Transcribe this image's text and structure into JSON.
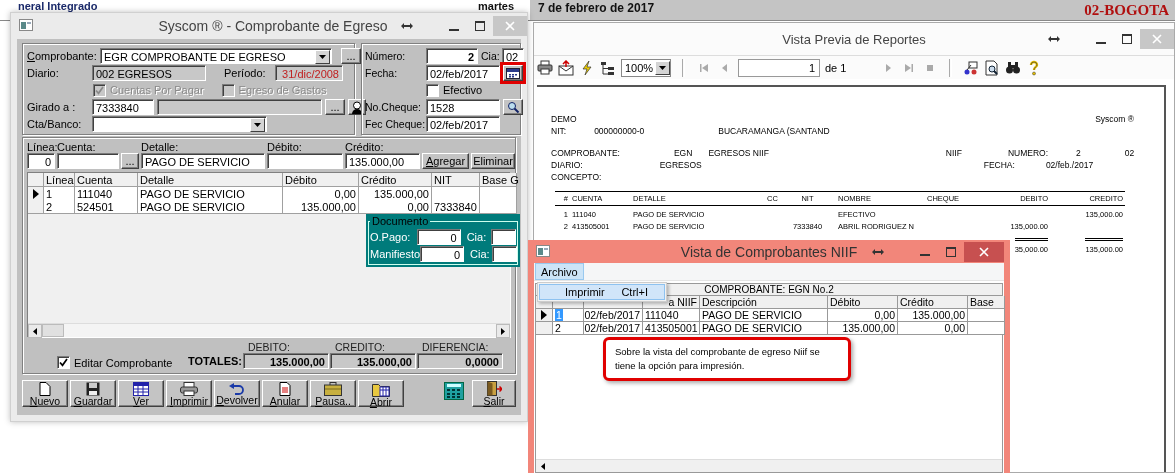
{
  "background": {
    "app_title": "neral Integrado",
    "weekday": "martes",
    "date": "7 de febrero de 2017",
    "branch": "02-BOGOTA"
  },
  "egreso_window": {
    "title": "Syscom ® - Comprobante de Egreso",
    "comprobante": {
      "label": "Comprobante:",
      "value": "EGR COMPROBANTE DE EGRESO",
      "button": "..."
    },
    "diario": {
      "label": "Diario:",
      "value": "002 EGRESOS"
    },
    "periodo": {
      "label": "Período:",
      "value": "31/dic/2008"
    },
    "options": [
      {
        "label": "Cuentas Por Pagar",
        "checked": true,
        "disabled": true
      },
      {
        "label": "Egreso de Gastos",
        "checked": false,
        "disabled": true
      }
    ],
    "girado_a": {
      "label": "Girado a :",
      "value": "7333840",
      "button": "..."
    },
    "cta_banco": {
      "label": "Cta/Banco:"
    },
    "numero": {
      "label": "Número:",
      "value": "2"
    },
    "cia": {
      "label": "Cia:",
      "value": "02"
    },
    "fecha": {
      "label": "Fecha:",
      "value": "02/feb/2017",
      "calendar_highlighted": true
    },
    "efectivo": {
      "label": "Efectivo",
      "checked": false
    },
    "no_cheque": {
      "label": "No.Cheque:",
      "value": "1528"
    },
    "fec_cheque": {
      "label": "Fec Cheque:",
      "value": "02/feb/2017"
    },
    "entry": {
      "labels": [
        "Línea:",
        "Cuenta:",
        "Detalle:",
        "Débito:",
        "Crédito:"
      ],
      "linea": "0",
      "button": "...",
      "detalle": "PAGO DE SERVICIO",
      "credito": "135.000,00"
    },
    "entry_buttons": [
      "Agregar",
      "Eliminar"
    ],
    "grid": {
      "columns": [
        "Línea",
        "Cuenta",
        "Detalle",
        "Débito",
        "Crédito",
        "NIT",
        "Base G"
      ],
      "rows": [
        {
          "selected": true,
          "linea": "1",
          "cuenta": "111040",
          "detalle": "PAGO DE SERVICIO",
          "debito": "0,00",
          "credito": "135.000,00"
        },
        {
          "selected": false,
          "linea": "2",
          "cuenta": "524501",
          "detalle": "PAGO DE SERVICIO",
          "debito": "135.000,00",
          "credito": "0,00",
          "nit": "7333840"
        }
      ]
    },
    "documento": {
      "legend": "Documento",
      "fields": [
        {
          "label": "O.Pago:",
          "value": "0",
          "cia_label": "Cia:"
        },
        {
          "label": "Manifiesto",
          "value": "0",
          "cia_label": "Cia:"
        }
      ]
    },
    "totals": {
      "headings": [
        "DEBITO:",
        "CREDITO:",
        "DIFERENCIA:"
      ],
      "label": "TOTALES:",
      "values": [
        "135.000,00",
        "135.000,00",
        "0,0000"
      ]
    },
    "editar": {
      "label": "Editar Comprobante",
      "checked": true
    },
    "buttons": [
      {
        "kind": "new",
        "label": "Nuevo"
      },
      {
        "kind": "save",
        "label": "Guardar"
      },
      {
        "kind": "view",
        "label": "Ver"
      },
      {
        "kind": "print",
        "label": "Imprimir"
      },
      {
        "kind": "return",
        "label": "Devolver"
      },
      {
        "kind": "cancel",
        "label": "Anular"
      },
      {
        "kind": "pause",
        "label": "Pausa.."
      },
      {
        "kind": "open",
        "label": "Abrir"
      },
      {
        "kind": "calculator"
      },
      {
        "kind": "exit",
        "label": "Salir"
      }
    ]
  },
  "report_window": {
    "title": "Vista Previa de Reportes",
    "zoom": "100%",
    "page": "1",
    "page_of": "de 1",
    "report": {
      "company": "DEMO",
      "brand": "Syscom ®",
      "nit_label": "NIT:",
      "nit": "000000000-0",
      "city": "BUCARAMANGA (SANTAND",
      "comprobante_label": "COMPROBANTE:",
      "comprobante_code": "EGN",
      "comprobante_name": "EGRESOS NIIF",
      "norma": "NIIF",
      "numero_label": "NUMERO:",
      "numero": "2",
      "cia": "02",
      "diario_label": "DIARIO:",
      "diario": "EGRESOS",
      "fecha_label": "FECHA:",
      "fecha": "02/feb./2017",
      "concepto_label": "CONCEPTO:",
      "columns": [
        "#",
        "CUENTA",
        "DETALLE",
        "CC",
        "NIT",
        "NOMBRE",
        "CHEQUE",
        "DEBITO",
        "CREDITO"
      ],
      "rows": [
        {
          "n": "1",
          "cuenta": "111040",
          "detalle": "PAGO DE SERVICIO",
          "nombre": "EFECTIVO",
          "credito": "135,000.00"
        },
        {
          "n": "2",
          "cuenta": "413505001",
          "detalle": "PAGO DE SERVICIO",
          "nit": "7333840",
          "nombre": "ABRIL RODRIGUEZ N",
          "debito": "135,000.00"
        }
      ],
      "totals": {
        "debito": "35,000.00",
        "credito": "135,000.00"
      }
    }
  },
  "niif_window": {
    "title": "Vista de Comprobantes NIIF",
    "menu": [
      {
        "label": "Archivo",
        "selected": true
      }
    ],
    "menu_items": [
      {
        "label": "Imprimir",
        "shortcut": "Ctrl+I"
      }
    ],
    "caption": "COMPROBANTE: EGN No.2",
    "columns": [
      "a NIIF",
      "Descripción",
      "Débito",
      "Crédito",
      "Base"
    ],
    "rows": [
      {
        "selected": true,
        "linea": "1",
        "fecha": "02/feb/2017",
        "cuenta": "111040",
        "descripcion": "PAGO DE SERVICIO",
        "debito": "0,00",
        "credito": "135.000,00"
      },
      {
        "selected": false,
        "linea": "2",
        "fecha": "02/feb/2017",
        "cuenta": "413505001",
        "descripcion": "PAGO DE SERVICIO",
        "debito": "135.000,00",
        "credito": "0,00"
      }
    ],
    "note": "Sobre la vista del comprobante de egreso Niif se tiene la opción para impresión."
  }
}
